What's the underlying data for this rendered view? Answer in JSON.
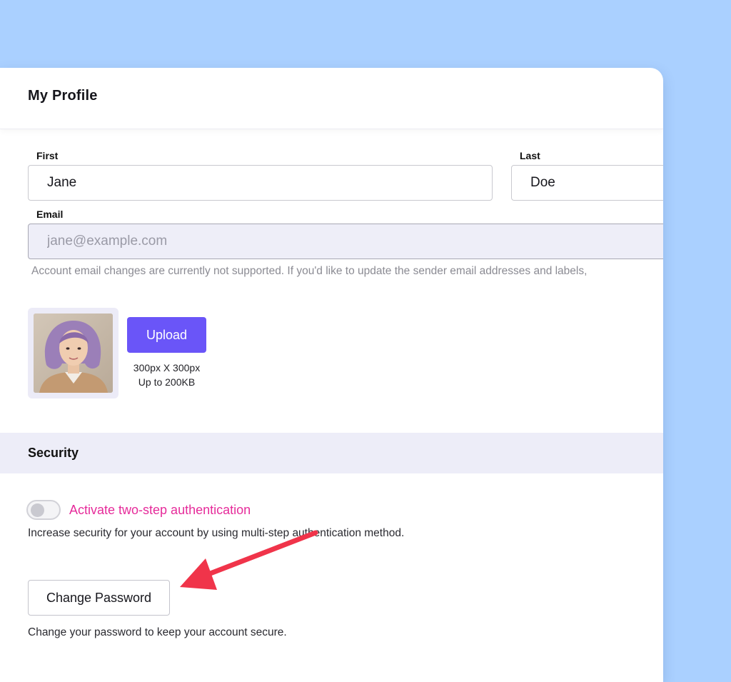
{
  "header": {
    "title": "My Profile"
  },
  "name": {
    "first_label": "First",
    "first_value": "Jane",
    "last_label": "Last",
    "last_value": "Doe"
  },
  "email": {
    "label": "Email",
    "placeholder": "jane@example.com",
    "hint": "Account email changes are currently not supported. If you'd like to update the sender email addresses and labels,"
  },
  "avatar": {
    "upload_label": "Upload",
    "size_spec": "300px X 300px",
    "weight_spec": "Up to 200KB"
  },
  "security": {
    "title": "Security",
    "two_step_label": "Activate two-step authentication",
    "two_step_enabled": false,
    "two_step_description": "Increase security for your account by using multi-step authentication method.",
    "change_password_label": "Change Password",
    "change_password_description": "Change your password to keep your account secure."
  },
  "colors": {
    "background": "#aad0ff",
    "accent": "#6a55f8",
    "toggle_label": "#e62b9a",
    "annotation_arrow": "#f0344a"
  },
  "icons": {
    "annotation": "arrow-annotation-icon"
  }
}
